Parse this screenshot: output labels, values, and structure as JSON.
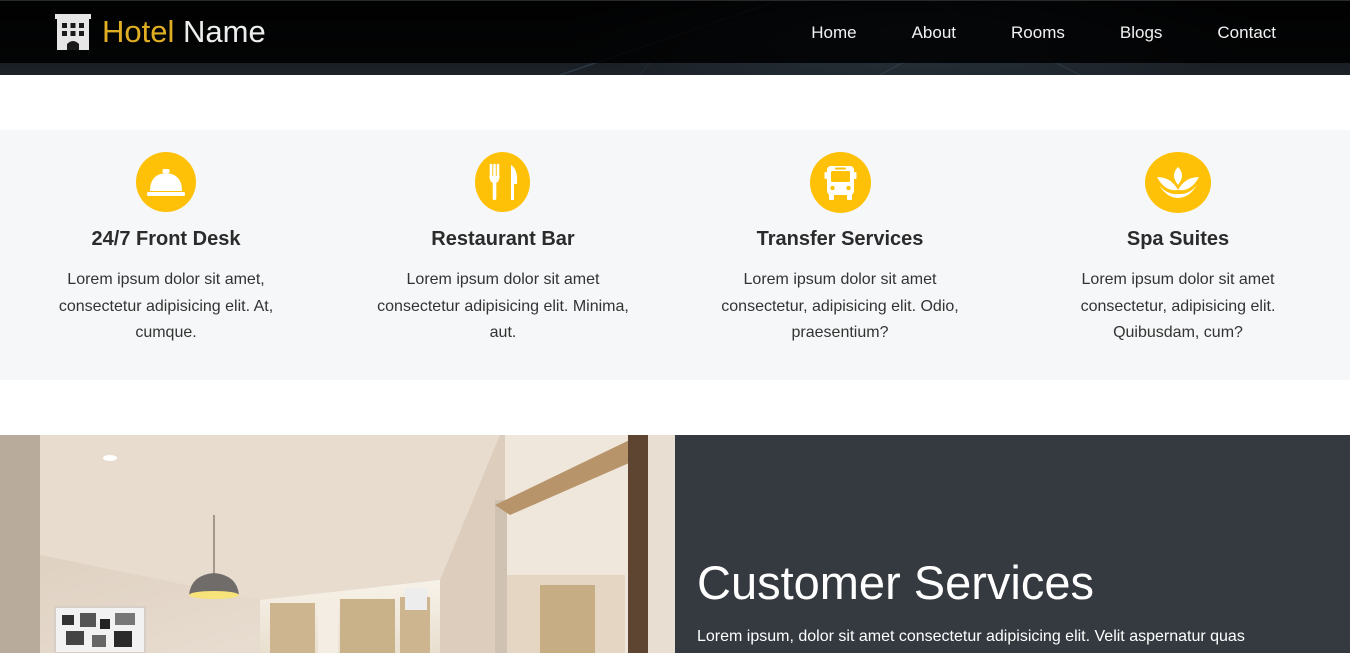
{
  "brand": {
    "name_accent": "Hotel",
    "name_rest": " Name",
    "icon": "hotel-building-icon",
    "accent_color": "#e0ae22"
  },
  "nav": {
    "items": [
      {
        "label": "Home"
      },
      {
        "label": "About"
      },
      {
        "label": "Rooms"
      },
      {
        "label": "Blogs"
      },
      {
        "label": "Contact"
      }
    ]
  },
  "services": {
    "accent_color": "#ffc107",
    "items": [
      {
        "icon": "concierge-bell-icon",
        "title": "24/7 Front Desk",
        "text": "Lorem ipsum dolor sit amet, consectetur adipisicing elit. At, cumque."
      },
      {
        "icon": "utensils-icon",
        "title": "Restaurant Bar",
        "text": "Lorem ipsum dolor sit amet consectetur adipisicing elit. Minima, aut."
      },
      {
        "icon": "bus-icon",
        "title": "Transfer Services",
        "text": "Lorem ipsum dolor sit amet consectetur, adipisicing elit. Odio, praesentium?"
      },
      {
        "icon": "spa-lotus-icon",
        "title": "Spa Suites",
        "text": "Lorem ipsum dolor sit amet consectetur, adipisicing elit. Quibusdam, cum?"
      }
    ]
  },
  "customer_services": {
    "title": "Customer Services",
    "text": "Lorem ipsum, dolor sit amet consectetur adipisicing elit. Velit aspernatur quas",
    "panel_color": "#343a40"
  },
  "room_photo": {
    "icon": "hotel-room-photo"
  }
}
